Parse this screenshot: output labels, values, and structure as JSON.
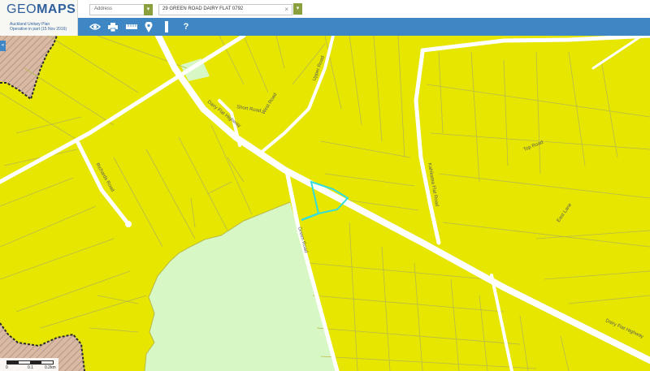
{
  "logo": {
    "word_light": "GEO",
    "word_heavy": "MAPS",
    "line1": "Auckland Unitary Plan",
    "line2": "Operative in part (15 Nov 2016)"
  },
  "search": {
    "type_value": "Address",
    "address_value": "29 GREEN ROAD DAIRY FLAT 0792",
    "clear_symbol": "×",
    "dropdown_symbol": "▾"
  },
  "toolbar": {
    "tools": [
      "view-tool",
      "print-tool",
      "measure-tool",
      "marker-tool",
      "ruler-tool",
      "help-tool"
    ],
    "help_label": "?"
  },
  "map": {
    "colors": {
      "residential_yellow": "#e6e600",
      "open_space_green": "#d7f7c4",
      "hatched_zone": "#d9b9a4",
      "selected_parcel": "#33dddd",
      "road": "#ffffff",
      "parcel_line": "#b9b94a",
      "toolbar_blue": "#3f87c4"
    },
    "road_labels": {
      "dairy_flat_highway_nw": "Dairy Flat Highway",
      "dairy_flat_highway_se": "Dairy Flat Highway",
      "green_road": "Green Road",
      "kahikatea_flat": "Kahikatea Flat Road",
      "top_road": "Top Road",
      "richards_road": "Richards Road",
      "upper_road": "Upper Road",
      "west_road": "West Road",
      "east_lane": "East Lane",
      "short_road": "Short Road"
    },
    "side_toggle": "«"
  },
  "scale": {
    "t0": "0",
    "t1": "0.1",
    "t2": "0.2km"
  }
}
